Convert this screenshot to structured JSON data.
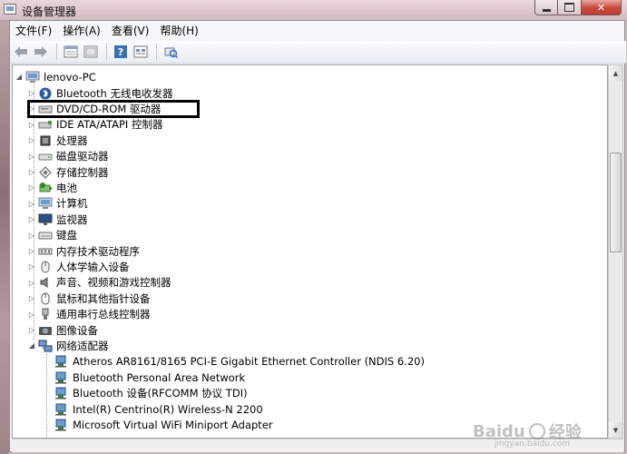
{
  "window": {
    "title": "设备管理器"
  },
  "menu": [
    {
      "label": "文件(F)"
    },
    {
      "label": "操作(A)"
    },
    {
      "label": "查看(V)"
    },
    {
      "label": "帮助(H)"
    }
  ],
  "toolbar": {
    "buttons": [
      {
        "icon": "back-arrow-icon"
      },
      {
        "icon": "forward-arrow-icon"
      },
      {
        "icon": "properties-icon"
      },
      {
        "icon": "show-hide-icon"
      },
      {
        "icon": "help-icon"
      },
      {
        "icon": "view-icon"
      },
      {
        "icon": "scan-hardware-icon"
      }
    ]
  },
  "tree": {
    "root": "lenovo-PC",
    "categories": [
      {
        "label": "Bluetooth 无线电收发器",
        "icon": "bluetooth-icon"
      },
      {
        "label": "DVD/CD-ROM 驱动器",
        "icon": "dvd-drive-icon"
      },
      {
        "label": "IDE ATA/ATAPI 控制器",
        "icon": "ide-controller-icon"
      },
      {
        "label": "处理器",
        "icon": "processor-icon"
      },
      {
        "label": "磁盘驱动器",
        "icon": "disk-drive-icon"
      },
      {
        "label": "存储控制器",
        "icon": "storage-controller-icon"
      },
      {
        "label": "电池",
        "icon": "battery-icon"
      },
      {
        "label": "计算机",
        "icon": "computer-icon"
      },
      {
        "label": "监视器",
        "icon": "monitor-icon"
      },
      {
        "label": "键盘",
        "icon": "keyboard-icon"
      },
      {
        "label": "内存技术驱动程序",
        "icon": "memory-driver-icon"
      },
      {
        "label": "人体学输入设备",
        "icon": "hid-icon"
      },
      {
        "label": "声音、视频和游戏控制器",
        "icon": "sound-icon"
      },
      {
        "label": "鼠标和其他指针设备",
        "icon": "mouse-icon"
      },
      {
        "label": "通用串行总线控制器",
        "icon": "usb-icon"
      },
      {
        "label": "图像设备",
        "icon": "imaging-icon"
      },
      {
        "label": "网络适配器",
        "icon": "network-adapter-icon"
      }
    ],
    "network_children": [
      {
        "label": "Atheros AR8161/8165 PCI-E Gigabit Ethernet Controller (NDIS 6.20)"
      },
      {
        "label": "Bluetooth Personal Area Network"
      },
      {
        "label": "Bluetooth 设备(RFCOMM 协议 TDI)"
      },
      {
        "label": "Intel(R) Centrino(R) Wireless-N 2200"
      },
      {
        "label": "Microsoft Virtual WiFi Miniport Adapter"
      }
    ]
  },
  "watermark": {
    "text": "Baidu",
    "suffix": "经验",
    "url": "jingyan.baidu.com"
  }
}
